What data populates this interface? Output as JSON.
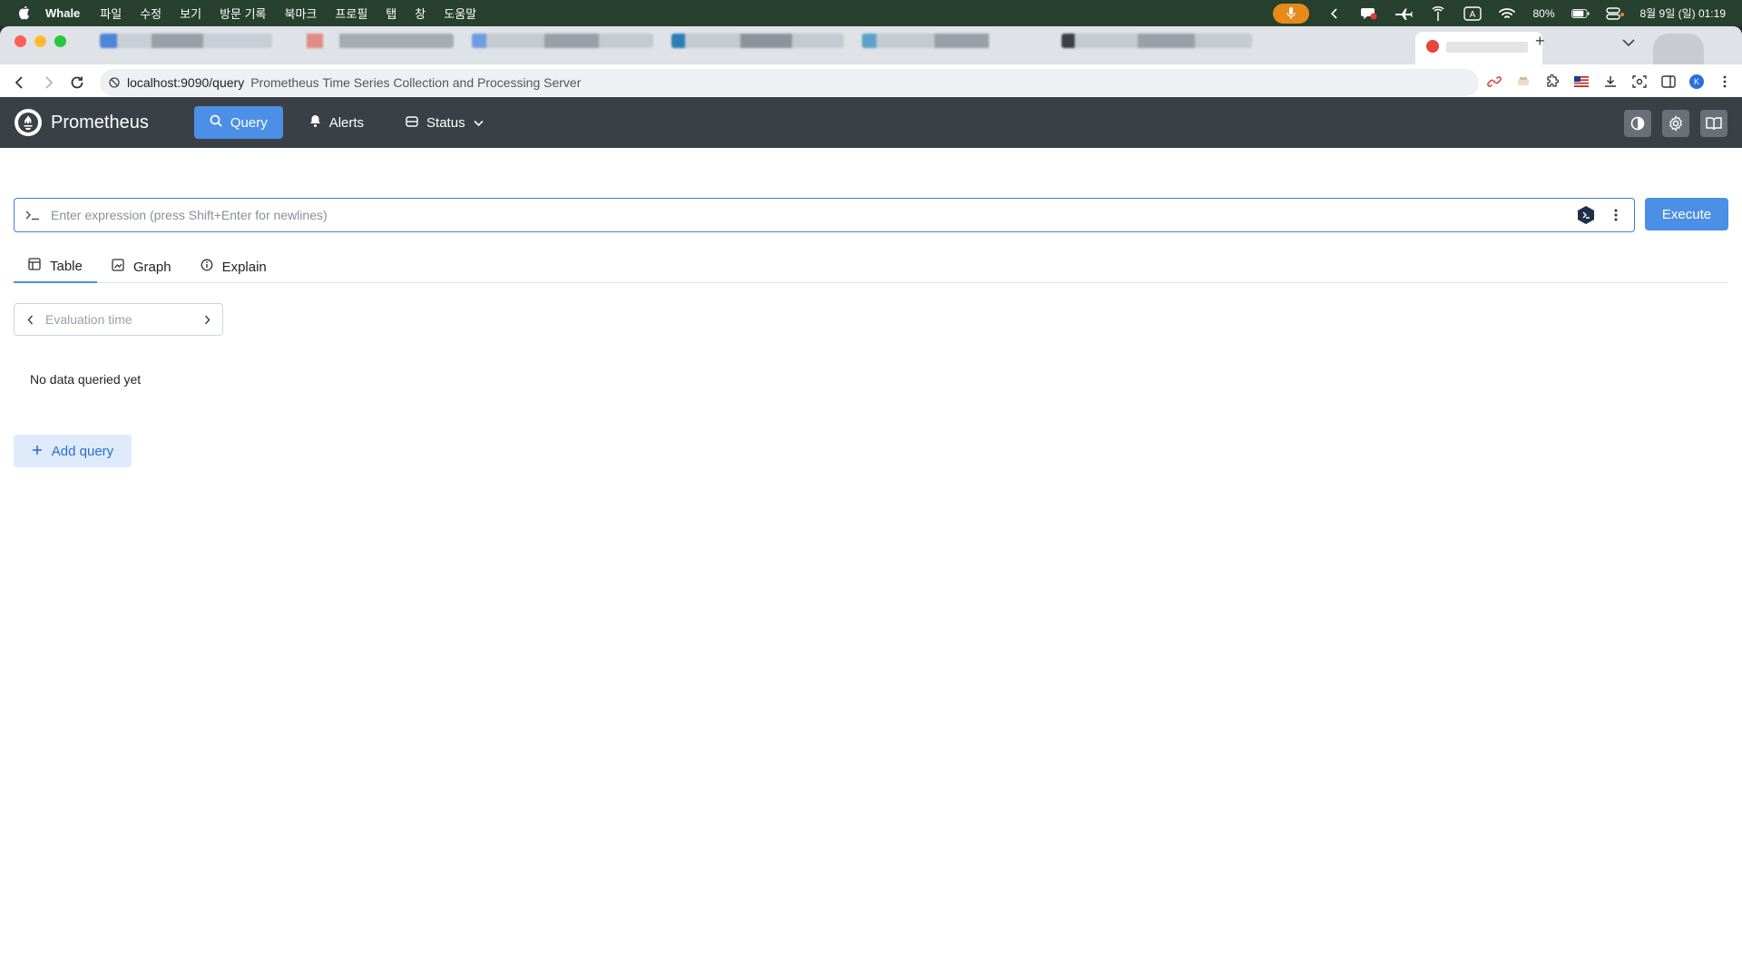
{
  "menubar": {
    "app_name": "Whale",
    "items": [
      "파일",
      "수정",
      "보기",
      "방문 기록",
      "북마크",
      "프로필",
      "탭",
      "창",
      "도움말"
    ],
    "battery": "80%",
    "datetime": "8월 9일 (일) 01:19"
  },
  "browser": {
    "url": "localhost:9090/query",
    "page_title": "Prometheus Time Series Collection and Processing Server",
    "profile_initial": "K"
  },
  "app": {
    "brand": "Prometheus",
    "nav": {
      "query": "Query",
      "alerts": "Alerts",
      "status": "Status"
    },
    "expression_placeholder": "Enter expression (press Shift+Enter for newlines)",
    "execute_label": "Execute",
    "tabs": {
      "table": "Table",
      "graph": "Graph",
      "explain": "Explain"
    },
    "evaluation_time_placeholder": "Evaluation time",
    "no_data": "No data queried yet",
    "add_query": "Add query"
  },
  "colors": {
    "header_bg": "#3b4047",
    "accent": "#4c8fe6",
    "add_query_bg": "#dfebfa"
  }
}
